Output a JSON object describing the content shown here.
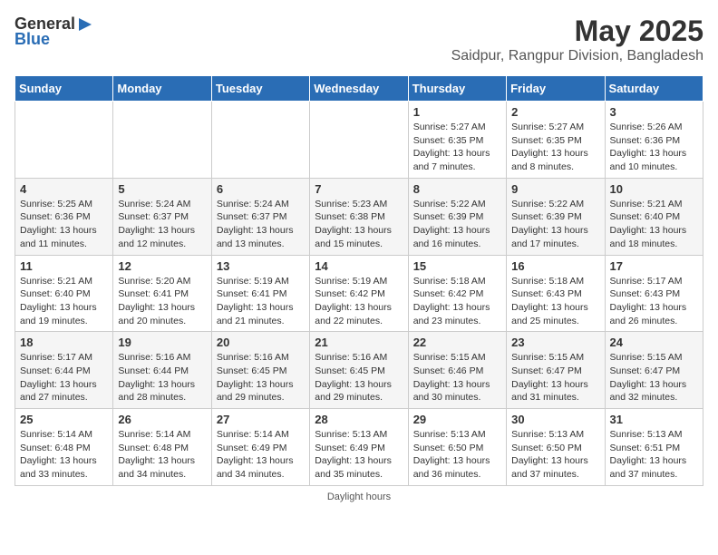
{
  "app": {
    "logo_general": "General",
    "logo_blue": "Blue"
  },
  "title": "May 2025",
  "subtitle": "Saidpur, Rangpur Division, Bangladesh",
  "columns": [
    "Sunday",
    "Monday",
    "Tuesday",
    "Wednesday",
    "Thursday",
    "Friday",
    "Saturday"
  ],
  "weeks": [
    [
      {
        "day": "",
        "info": ""
      },
      {
        "day": "",
        "info": ""
      },
      {
        "day": "",
        "info": ""
      },
      {
        "day": "",
        "info": ""
      },
      {
        "day": "1",
        "info": "Sunrise: 5:27 AM\nSunset: 6:35 PM\nDaylight: 13 hours and 7 minutes."
      },
      {
        "day": "2",
        "info": "Sunrise: 5:27 AM\nSunset: 6:35 PM\nDaylight: 13 hours and 8 minutes."
      },
      {
        "day": "3",
        "info": "Sunrise: 5:26 AM\nSunset: 6:36 PM\nDaylight: 13 hours and 10 minutes."
      }
    ],
    [
      {
        "day": "4",
        "info": "Sunrise: 5:25 AM\nSunset: 6:36 PM\nDaylight: 13 hours and 11 minutes."
      },
      {
        "day": "5",
        "info": "Sunrise: 5:24 AM\nSunset: 6:37 PM\nDaylight: 13 hours and 12 minutes."
      },
      {
        "day": "6",
        "info": "Sunrise: 5:24 AM\nSunset: 6:37 PM\nDaylight: 13 hours and 13 minutes."
      },
      {
        "day": "7",
        "info": "Sunrise: 5:23 AM\nSunset: 6:38 PM\nDaylight: 13 hours and 15 minutes."
      },
      {
        "day": "8",
        "info": "Sunrise: 5:22 AM\nSunset: 6:39 PM\nDaylight: 13 hours and 16 minutes."
      },
      {
        "day": "9",
        "info": "Sunrise: 5:22 AM\nSunset: 6:39 PM\nDaylight: 13 hours and 17 minutes."
      },
      {
        "day": "10",
        "info": "Sunrise: 5:21 AM\nSunset: 6:40 PM\nDaylight: 13 hours and 18 minutes."
      }
    ],
    [
      {
        "day": "11",
        "info": "Sunrise: 5:21 AM\nSunset: 6:40 PM\nDaylight: 13 hours and 19 minutes."
      },
      {
        "day": "12",
        "info": "Sunrise: 5:20 AM\nSunset: 6:41 PM\nDaylight: 13 hours and 20 minutes."
      },
      {
        "day": "13",
        "info": "Sunrise: 5:19 AM\nSunset: 6:41 PM\nDaylight: 13 hours and 21 minutes."
      },
      {
        "day": "14",
        "info": "Sunrise: 5:19 AM\nSunset: 6:42 PM\nDaylight: 13 hours and 22 minutes."
      },
      {
        "day": "15",
        "info": "Sunrise: 5:18 AM\nSunset: 6:42 PM\nDaylight: 13 hours and 23 minutes."
      },
      {
        "day": "16",
        "info": "Sunrise: 5:18 AM\nSunset: 6:43 PM\nDaylight: 13 hours and 25 minutes."
      },
      {
        "day": "17",
        "info": "Sunrise: 5:17 AM\nSunset: 6:43 PM\nDaylight: 13 hours and 26 minutes."
      }
    ],
    [
      {
        "day": "18",
        "info": "Sunrise: 5:17 AM\nSunset: 6:44 PM\nDaylight: 13 hours and 27 minutes."
      },
      {
        "day": "19",
        "info": "Sunrise: 5:16 AM\nSunset: 6:44 PM\nDaylight: 13 hours and 28 minutes."
      },
      {
        "day": "20",
        "info": "Sunrise: 5:16 AM\nSunset: 6:45 PM\nDaylight: 13 hours and 29 minutes."
      },
      {
        "day": "21",
        "info": "Sunrise: 5:16 AM\nSunset: 6:45 PM\nDaylight: 13 hours and 29 minutes."
      },
      {
        "day": "22",
        "info": "Sunrise: 5:15 AM\nSunset: 6:46 PM\nDaylight: 13 hours and 30 minutes."
      },
      {
        "day": "23",
        "info": "Sunrise: 5:15 AM\nSunset: 6:47 PM\nDaylight: 13 hours and 31 minutes."
      },
      {
        "day": "24",
        "info": "Sunrise: 5:15 AM\nSunset: 6:47 PM\nDaylight: 13 hours and 32 minutes."
      }
    ],
    [
      {
        "day": "25",
        "info": "Sunrise: 5:14 AM\nSunset: 6:48 PM\nDaylight: 13 hours and 33 minutes."
      },
      {
        "day": "26",
        "info": "Sunrise: 5:14 AM\nSunset: 6:48 PM\nDaylight: 13 hours and 34 minutes."
      },
      {
        "day": "27",
        "info": "Sunrise: 5:14 AM\nSunset: 6:49 PM\nDaylight: 13 hours and 34 minutes."
      },
      {
        "day": "28",
        "info": "Sunrise: 5:13 AM\nSunset: 6:49 PM\nDaylight: 13 hours and 35 minutes."
      },
      {
        "day": "29",
        "info": "Sunrise: 5:13 AM\nSunset: 6:50 PM\nDaylight: 13 hours and 36 minutes."
      },
      {
        "day": "30",
        "info": "Sunrise: 5:13 AM\nSunset: 6:50 PM\nDaylight: 13 hours and 37 minutes."
      },
      {
        "day": "31",
        "info": "Sunrise: 5:13 AM\nSunset: 6:51 PM\nDaylight: 13 hours and 37 minutes."
      }
    ]
  ],
  "footer": "Daylight hours"
}
